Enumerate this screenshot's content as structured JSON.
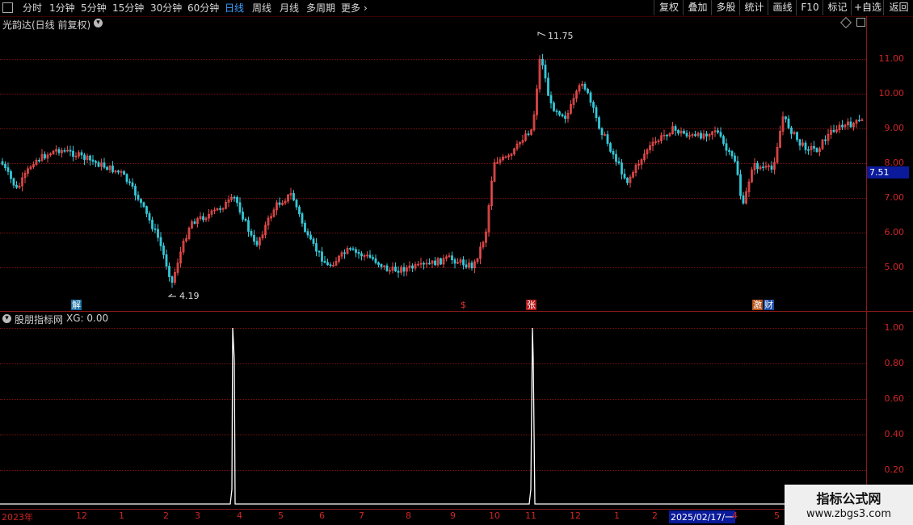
{
  "toolbar": {
    "periods": [
      "分时",
      "1分钟",
      "5分钟",
      "15分钟",
      "30分钟",
      "60分钟",
      "日线",
      "周线",
      "月线",
      "多周期",
      "更多"
    ],
    "active_period": "日线",
    "buttons": [
      "复权",
      "叠加",
      "多股",
      "统计",
      "画线",
      "F10",
      "标记",
      "+自选",
      "返回"
    ]
  },
  "main_pane": {
    "title": "光韵达(日线 前复权)",
    "price_axis": [
      "11.00",
      "10.00",
      "9.00",
      "8.00",
      "7.00",
      "6.00",
      "5.00"
    ],
    "current_price": "7.51",
    "high_label": "11.75",
    "low_label": "4.19",
    "markers": [
      {
        "text": "解",
        "color": "#1e88c8"
      },
      {
        "text": "$",
        "color": "#d02020"
      },
      {
        "text": "张",
        "color": "#d02020"
      },
      {
        "text": "激",
        "color": "#d06020"
      },
      {
        "text": "财",
        "color": "#2060c0"
      }
    ],
    "colors": {
      "up": "#e84a4a",
      "down": "#35c8d8"
    }
  },
  "sub_pane": {
    "title": "股朋指标网",
    "indicator": "XG: 0.00",
    "axis": [
      "1.00",
      "0.80",
      "0.60",
      "0.40",
      "0.20"
    ]
  },
  "date_axis": {
    "labels": [
      "2023年",
      "12",
      "1",
      "2",
      "3",
      "4",
      "5",
      "6",
      "7",
      "8",
      "9",
      "10",
      "11",
      "12",
      "1",
      "2",
      "2025/02/17/一",
      "4",
      "5"
    ]
  },
  "watermark": {
    "line1": "指标公式网",
    "line2": "www.zbgs3.com"
  }
}
